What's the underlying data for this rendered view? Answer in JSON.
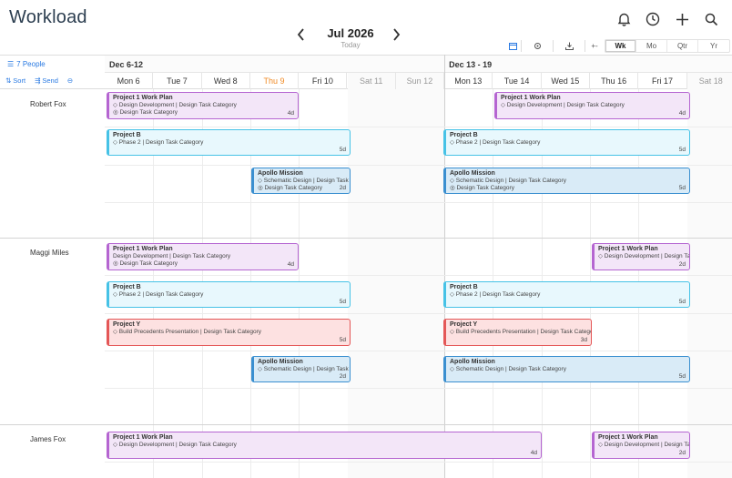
{
  "header": {
    "title": "Workload",
    "month": "Jul 2026",
    "today_label": "Today",
    "icons": [
      "bell-icon",
      "clock-icon",
      "plus-icon",
      "search-icon"
    ]
  },
  "toolbar": {
    "view_tabs": [
      "Wk",
      "Mo",
      "Qtr",
      "Yr"
    ],
    "active_view": "Wk",
    "zoom_label": "+-"
  },
  "left_panel": {
    "people_label": "7 People",
    "sort_label": "Sort",
    "send_label": "Send"
  },
  "weeks": [
    {
      "label": "Dec 6-12"
    },
    {
      "label": "Dec 13 - 19"
    }
  ],
  "days": [
    {
      "label": "Mon 6",
      "weekend": false,
      "today": false
    },
    {
      "label": "Tue 7",
      "weekend": false,
      "today": false
    },
    {
      "label": "Wed 8",
      "weekend": false,
      "today": false
    },
    {
      "label": "Thu 9",
      "weekend": false,
      "today": true
    },
    {
      "label": "Fri 10",
      "weekend": false,
      "today": false
    },
    {
      "label": "Sat 11",
      "weekend": true,
      "today": false
    },
    {
      "label": "Sun 12",
      "weekend": true,
      "today": false
    },
    {
      "label": "Mon 13",
      "weekend": false,
      "today": false
    },
    {
      "label": "Tue 14",
      "weekend": false,
      "today": false
    },
    {
      "label": "Wed 15",
      "weekend": false,
      "today": false
    },
    {
      "label": "Thu 16",
      "weekend": false,
      "today": false
    },
    {
      "label": "Fri 17",
      "weekend": false,
      "today": false
    },
    {
      "label": "Sat 18",
      "weekend": true,
      "today": false
    }
  ],
  "people": [
    {
      "name": "Robert Fox"
    },
    {
      "name": "Maggi Miles"
    },
    {
      "name": "James Fox"
    }
  ],
  "bars": [
    {
      "color": "purple",
      "person": 0,
      "lane": 0,
      "title": "Project 1 Work Plan",
      "lines": [
        "◇ Design Development | Design Task Category",
        "◎ Design Task Category"
      ],
      "duration": "4d"
    },
    {
      "color": "purple",
      "person": 0,
      "lane": 0,
      "title": "Project 1 Work Plan",
      "lines": [
        "◇ Design Development | Design Task Category"
      ],
      "duration": "4d"
    },
    {
      "color": "cyan",
      "person": 0,
      "lane": 1,
      "title": "Project B",
      "lines": [
        "◇ Phase 2 | Design Task Category"
      ],
      "duration": "5d"
    },
    {
      "color": "cyan",
      "person": 0,
      "lane": 1,
      "title": "Project B",
      "lines": [
        "◇ Phase 2 | Design Task Category"
      ],
      "duration": "5d"
    },
    {
      "color": "blue",
      "person": 0,
      "lane": 2,
      "title": "Apollo Mission",
      "lines": [
        "◇ Schematic Design | Design Task Category",
        "◎ Design Task Category"
      ],
      "duration": "2d"
    },
    {
      "color": "blue",
      "person": 0,
      "lane": 2,
      "title": "Apollo Mission",
      "lines": [
        "◇ Schematic Design | Design Task Category",
        "◎ Design Task Category"
      ],
      "duration": "5d"
    },
    {
      "color": "purple",
      "person": 1,
      "lane": 0,
      "title": "Project 1 Work Plan",
      "lines": [
        "Design Development | Design Task Category",
        "◎ Design Task Category"
      ],
      "duration": "4d"
    },
    {
      "color": "purple",
      "person": 1,
      "lane": 0,
      "title": "Project 1 Work Plan",
      "lines": [
        "◇ Design Development | Design Task Category"
      ],
      "duration": "2d"
    },
    {
      "color": "cyan",
      "person": 1,
      "lane": 1,
      "title": "Project B",
      "lines": [
        "◇ Phase 2 | Design Task Category"
      ],
      "duration": "5d"
    },
    {
      "color": "cyan",
      "person": 1,
      "lane": 1,
      "title": "Project B",
      "lines": [
        "◇ Phase 2 | Design Task Category"
      ],
      "duration": "5d"
    },
    {
      "color": "red",
      "person": 1,
      "lane": 2,
      "title": "Project Y",
      "lines": [
        "◇ Build Precedents Presentation | Design Task Category"
      ],
      "duration": "5d"
    },
    {
      "color": "red",
      "person": 1,
      "lane": 2,
      "title": "Project Y",
      "lines": [
        "◇ Build Precedents Presentation | Design Task Category"
      ],
      "duration": "3d"
    },
    {
      "color": "blue",
      "person": 1,
      "lane": 3,
      "title": "Apollo Mission",
      "lines": [
        "◇ Schematic Design | Design Task Category"
      ],
      "duration": "2d"
    },
    {
      "color": "blue",
      "person": 1,
      "lane": 3,
      "title": "Apollo Mission",
      "lines": [
        "◇ Schematic Design | Design Task Category"
      ],
      "duration": "5d"
    },
    {
      "color": "purple",
      "person": 2,
      "lane": 0,
      "title": "Project 1 Work Plan",
      "lines": [
        "◇ Design Development | Design Task Category"
      ],
      "duration": "4d"
    },
    {
      "color": "purple",
      "person": 2,
      "lane": 0,
      "title": "Project 1 Work Plan",
      "lines": [
        "◇ Design Development | Design Task Category"
      ],
      "duration": "2d"
    }
  ]
}
